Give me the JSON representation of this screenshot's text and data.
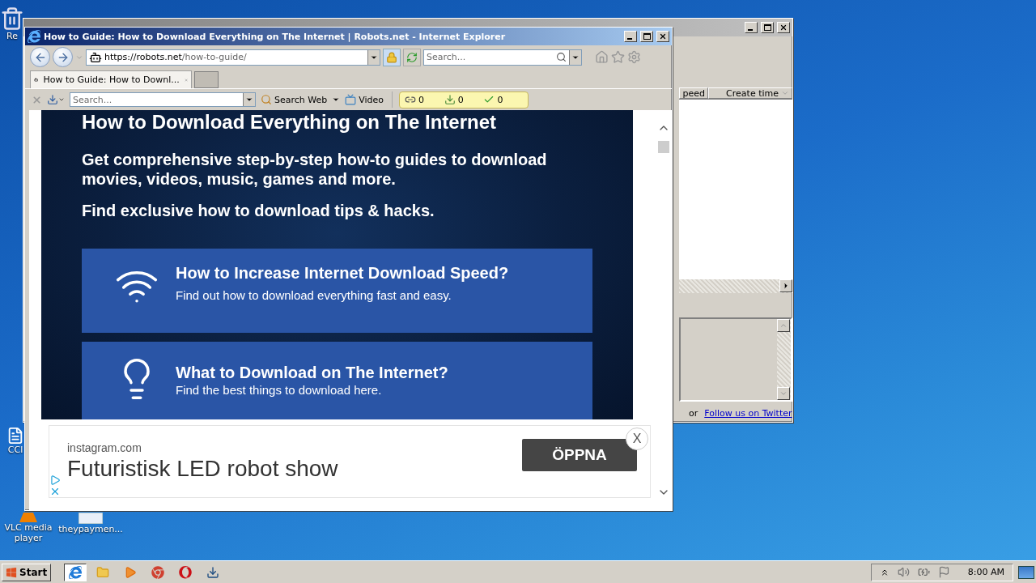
{
  "desktop_icons": [
    {
      "kind": "bin",
      "label": "Re"
    },
    {
      "kind": "shortcut",
      "label": "CCl"
    },
    {
      "kind": "vlc",
      "label": "VLC media player"
    },
    {
      "kind": "file",
      "label": "theypaymen..."
    }
  ],
  "back_window": {
    "columns": [
      "peed",
      "Create time"
    ],
    "footer_text": "or",
    "footer_link": "Follow us on Twitter"
  },
  "browser": {
    "title": "How to Guide: How to Download Everything on The Internet | Robots.net - Internet Explorer",
    "address": {
      "host": "https://robots.net",
      "path": "/how-to-guide/"
    },
    "search": {
      "placeholder": "Search..."
    },
    "tabs": [
      {
        "label": "How to Guide: How to Downl...",
        "selected": true
      }
    ],
    "toolbar": {
      "search": {
        "placeholder": "Search..."
      },
      "buttons": [
        {
          "kind": "search",
          "label": "Search Web"
        },
        {
          "kind": "video",
          "label": "Video"
        }
      ],
      "counters": [
        {
          "kind": "link",
          "value": "0"
        },
        {
          "kind": "download",
          "value": "0"
        },
        {
          "kind": "check",
          "value": "0"
        }
      ]
    },
    "page": {
      "heading": "How to Download Everything on The Internet",
      "intro": "Get comprehensive step-by-step how-to guides to download movies, videos, music, games and more.",
      "tagline": "Find exclusive how to download tips & hacks.",
      "cards": [
        {
          "kind": "speed",
          "title": "How to Increase Internet Download Speed?",
          "text": "Find out how to download everything fast and easy."
        },
        {
          "kind": "idea",
          "title": "What to Download on The Internet?",
          "text": "Find the best things to download here."
        }
      ]
    },
    "ad": {
      "domain": "instagram.com",
      "headline": "Futuristisk LED robot show",
      "button": "ÖPPNA",
      "close": "X"
    }
  },
  "taskbar": {
    "start": "Start",
    "apps": [
      {
        "kind": "ie",
        "selected": true
      },
      {
        "kind": "folder",
        "selected": false
      },
      {
        "kind": "media",
        "selected": false
      },
      {
        "kind": "chrome",
        "selected": false
      },
      {
        "kind": "opera",
        "selected": false
      },
      {
        "kind": "download",
        "selected": false
      }
    ],
    "clock": "8:00 AM"
  }
}
